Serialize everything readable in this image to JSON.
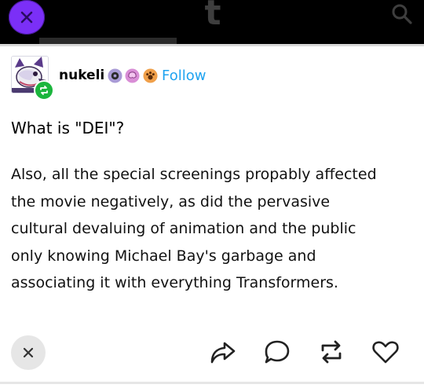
{
  "header": {
    "logo_text": "t",
    "colors": {
      "bar": "#000000",
      "close_button": "#7b2ff7",
      "logo": "#3e3e3e"
    },
    "icons": [
      "close-icon",
      "tumblr-logo",
      "search-icon"
    ]
  },
  "post": {
    "username": "nukeli",
    "follow_label": "Follow",
    "badge_icons": [
      "gear-badge-icon",
      "brain-badge-icon",
      "paw-badge-icon"
    ],
    "question": "What is \"DEI\"?",
    "body_lines": [
      "Also, all the special screenings propably affected",
      "the movie negatively, as did the pervasive",
      "cultural devaluing of animation and the public",
      "only knowing Michael Bay's garbage and",
      "associating it with everything Transformers."
    ],
    "colors": {
      "follow": "#1fa3f0",
      "reblog_badge": "#1bb53d"
    }
  },
  "actions": {
    "icons": [
      "close-icon",
      "share-icon",
      "reply-icon",
      "reblog-icon",
      "like-icon"
    ]
  }
}
